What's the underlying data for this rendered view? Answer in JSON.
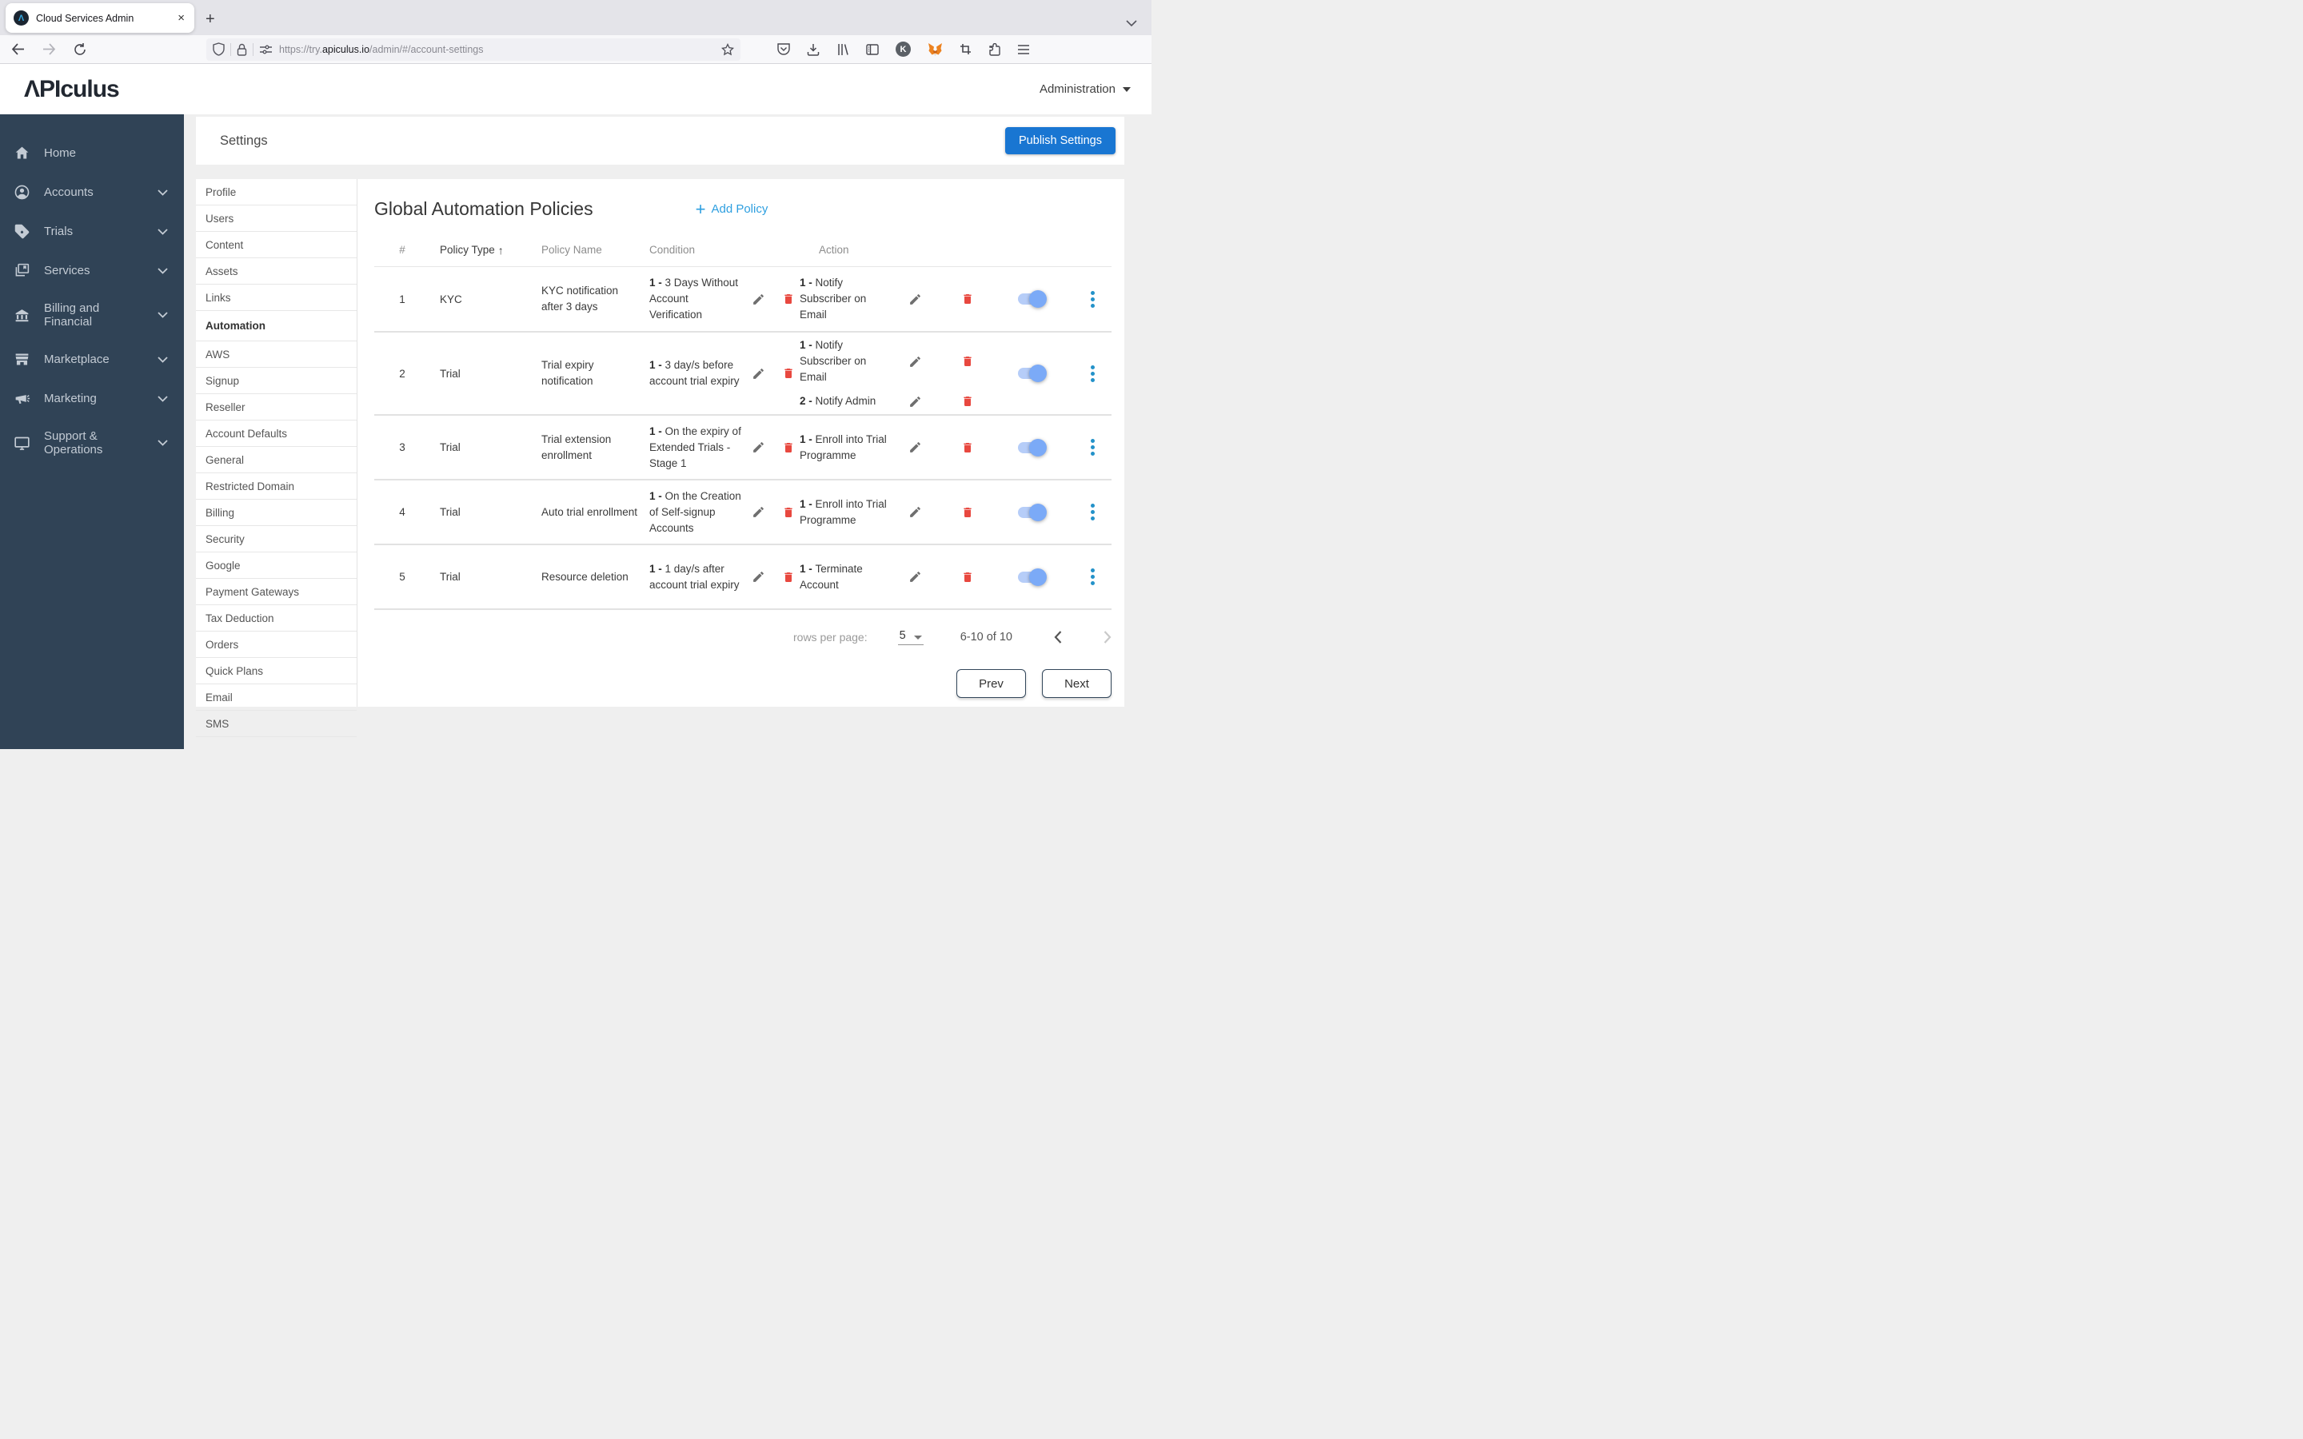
{
  "browser": {
    "tab_title": "Cloud Services Admin",
    "close_glyph": "×",
    "new_tab_glyph": "+",
    "url_prefix": "https://try.",
    "url_domain": "apiculus.io",
    "url_path": "/admin/#/account-settings",
    "toolbar_icons": [
      "pocket-icon",
      "download-icon",
      "library-icon",
      "sidebar-icon",
      "k-extension-icon",
      "metamask-icon",
      "screenshot-icon",
      "extensions-icon",
      "menu-icon"
    ]
  },
  "header": {
    "logo": "ΛPIculus",
    "user_menu": "Administration"
  },
  "sidebar": {
    "items": [
      {
        "label": "Home",
        "icon": "home",
        "has_children": false
      },
      {
        "label": "Accounts",
        "icon": "person",
        "has_children": true
      },
      {
        "label": "Trials",
        "icon": "tag",
        "has_children": true
      },
      {
        "label": "Services",
        "icon": "cards",
        "has_children": true
      },
      {
        "label": "Billing and Financial",
        "icon": "bank",
        "has_children": true
      },
      {
        "label": "Marketplace",
        "icon": "store",
        "has_children": true
      },
      {
        "label": "Marketing",
        "icon": "megaphone",
        "has_children": true
      },
      {
        "label": "Support & Operations",
        "icon": "monitor",
        "has_children": true
      }
    ]
  },
  "settings": {
    "title": "Settings",
    "publish_button": "Publish Settings",
    "nav": [
      "Profile",
      "Users",
      "Content",
      "Assets",
      "Links",
      "Automation",
      "AWS",
      "Signup",
      "Reseller",
      "Account Defaults",
      "General",
      "Restricted Domain",
      "Billing",
      "Security",
      "Google",
      "Payment Gateways",
      "Tax Deduction",
      "Orders",
      "Quick Plans",
      "Email",
      "SMS"
    ],
    "active_nav": "Automation"
  },
  "policies": {
    "title": "Global Automation Policies",
    "add_button": "Add Policy",
    "add_plus_glyph": "+",
    "columns": [
      "#",
      "Policy Type",
      "Policy Name",
      "Condition",
      "Action"
    ],
    "sort_column": "Policy Type",
    "sort_arrow_glyph": "↑",
    "rows": [
      {
        "num": "1",
        "type": "KYC",
        "name": "KYC notification after 3 days",
        "conditions": [
          {
            "prefix": "1 - ",
            "text": "3 Days Without Account Verification"
          }
        ],
        "actions": [
          {
            "prefix": "1 - ",
            "text": "Notify Subscriber on Email"
          }
        ],
        "enabled": true
      },
      {
        "num": "2",
        "type": "Trial",
        "name": "Trial expiry notification",
        "conditions": [
          {
            "prefix": "1 - ",
            "text": "3 day/s before account trial expiry"
          }
        ],
        "actions": [
          {
            "prefix": "1 - ",
            "text": "Notify Subscriber on Email"
          },
          {
            "prefix": "2 - ",
            "text": "Notify Admin"
          }
        ],
        "enabled": true
      },
      {
        "num": "3",
        "type": "Trial",
        "name": "Trial extension enrollment",
        "conditions": [
          {
            "prefix": "1 - ",
            "text": "On the expiry of Extended Trials - Stage 1"
          }
        ],
        "actions": [
          {
            "prefix": "1 - ",
            "text": "Enroll into Trial Programme"
          }
        ],
        "enabled": true
      },
      {
        "num": "4",
        "type": "Trial",
        "name": "Auto trial enrollment",
        "conditions": [
          {
            "prefix": "1 - ",
            "text": "On the Creation of Self-signup Accounts"
          }
        ],
        "actions": [
          {
            "prefix": "1 - ",
            "text": "Enroll into Trial Programme"
          }
        ],
        "enabled": true
      },
      {
        "num": "5",
        "type": "Trial",
        "name": "Resource deletion",
        "conditions": [
          {
            "prefix": "1 - ",
            "text": "1 day/s after account trial expiry"
          }
        ],
        "actions": [
          {
            "prefix": "1 - ",
            "text": "Terminate Account"
          }
        ],
        "enabled": true
      }
    ],
    "pagination": {
      "rows_per_page_label": "rows per page:",
      "rows_per_page": "5",
      "range": "6-10 of 10",
      "prev": "Prev",
      "next": "Next"
    }
  },
  "colors": {
    "publish_blue": "#1976d2",
    "link_blue": "#2e9fe0",
    "toggle_knob": "#7baaf7",
    "toggle_track": "#b6cdf8",
    "kebab_blue": "#2492c9",
    "delete_red": "#e8483f",
    "sidebar_bg": "#304356"
  }
}
